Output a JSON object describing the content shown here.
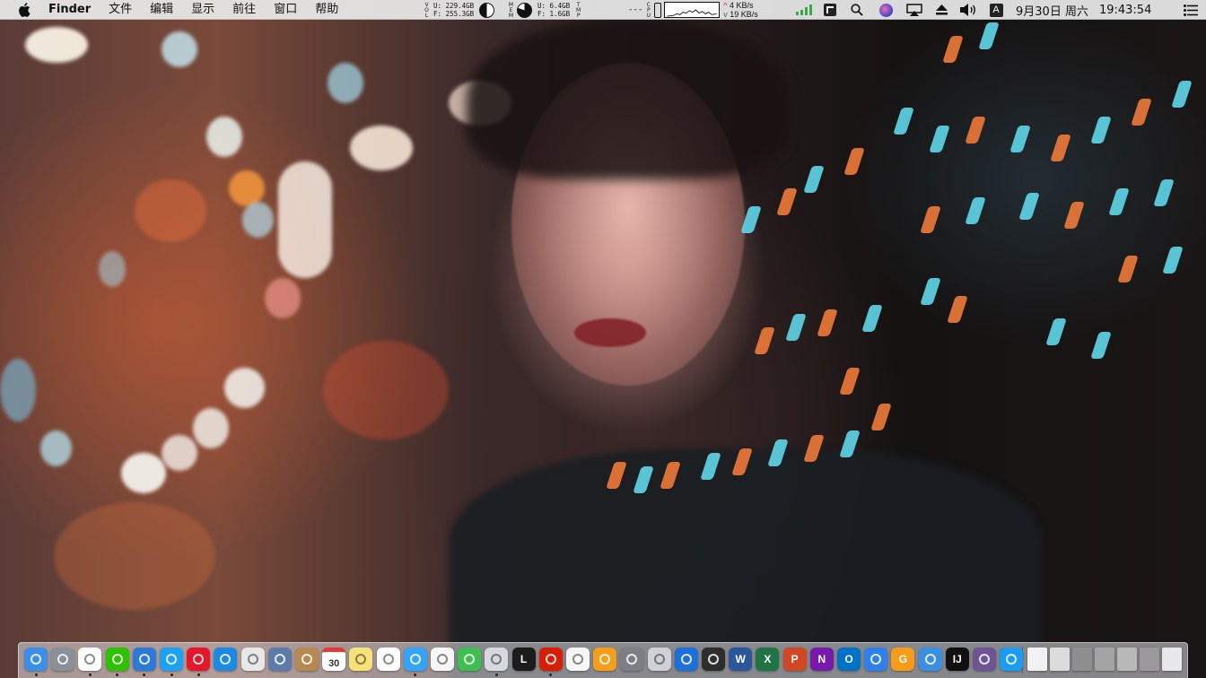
{
  "menubar": {
    "app_name": "Finder",
    "items": [
      "文件",
      "编辑",
      "显示",
      "前往",
      "窗口",
      "帮助"
    ]
  },
  "status": {
    "disk_label": "VOL",
    "disk_used": "U: 229.4GB",
    "disk_free": "F: 255.3GB",
    "mem_label": "MEM",
    "mem_used": "U:     6.4GB",
    "mem_free": "F:     1.6GB",
    "tmp_label": "TMP",
    "cpu_label": "CPU",
    "cpu_bars": "---",
    "net_up": "4 KB/s",
    "net_down": "19 KB/s",
    "input_method": "A",
    "date": "9月30日 周六",
    "time": "19:43:54"
  },
  "status_icons": [
    "signal-bars-icon",
    "screen-capture-icon",
    "spotlight-search-icon",
    "siri-icon",
    "airplay-icon",
    "eject-icon",
    "volume-icon",
    "input-method-icon",
    "notification-center-icon"
  ],
  "dock": {
    "calendar_day": "30",
    "items": [
      {
        "name": "finder-icon",
        "color": "#3d8ee8",
        "glyph": "",
        "dot": true
      },
      {
        "name": "launchpad-icon",
        "color": "#8a8f99",
        "glyph": "",
        "dot": false
      },
      {
        "name": "qq-icon",
        "color": "#ffffff",
        "glyph": "",
        "dot": true
      },
      {
        "name": "wechat-icon",
        "color": "#2dc100",
        "glyph": "",
        "dot": true
      },
      {
        "name": "mail-icon",
        "color": "#2d7ad6",
        "glyph": "",
        "dot": true
      },
      {
        "name": "twitter-icon",
        "color": "#1da1f2",
        "glyph": "",
        "dot": true
      },
      {
        "name": "weibo-icon",
        "color": "#e6162d",
        "glyph": "",
        "dot": true
      },
      {
        "name": "safari-icon",
        "color": "#1e88e5",
        "glyph": "",
        "dot": false
      },
      {
        "name": "chrome-icon",
        "color": "#e8e8e8",
        "glyph": "",
        "dot": false
      },
      {
        "name": "preview-icon",
        "color": "#5b7ba8",
        "glyph": "",
        "dot": false
      },
      {
        "name": "notebook-icon",
        "color": "#b5894f",
        "glyph": "",
        "dot": false
      },
      {
        "name": "calendar-icon",
        "color": "#ffffff",
        "glyph": "30",
        "dot": false
      },
      {
        "name": "stickies-icon",
        "color": "#f7e27a",
        "glyph": "",
        "dot": false
      },
      {
        "name": "reminders-icon",
        "color": "#fdfdfd",
        "glyph": "",
        "dot": false
      },
      {
        "name": "messages-icon",
        "color": "#35a3f7",
        "glyph": "",
        "dot": true
      },
      {
        "name": "photos-icon",
        "color": "#f7f7f7",
        "glyph": "",
        "dot": false
      },
      {
        "name": "infuse-icon",
        "color": "#3fbf4f",
        "glyph": "",
        "dot": false
      },
      {
        "name": "cloud-drive-icon",
        "color": "#d8d8e0",
        "glyph": "",
        "dot": true
      },
      {
        "name": "lightroom-icon",
        "color": "#1c1c1c",
        "glyph": "L",
        "dot": false
      },
      {
        "name": "netease-music-icon",
        "color": "#d81e06",
        "glyph": "",
        "dot": true
      },
      {
        "name": "itunes-icon",
        "color": "#f6f6f6",
        "glyph": "",
        "dot": false
      },
      {
        "name": "ibooks-icon",
        "color": "#f59e1b",
        "glyph": "",
        "dot": false
      },
      {
        "name": "system-preferences-icon",
        "color": "#7d7f84",
        "glyph": "",
        "dot": false
      },
      {
        "name": "tomato-timer-icon",
        "color": "#cfd1d6",
        "glyph": "",
        "dot": false
      },
      {
        "name": "qq-browser-icon",
        "color": "#1e6fd9",
        "glyph": "",
        "dot": false
      },
      {
        "name": "vim-icon",
        "color": "#2e2e2e",
        "glyph": "",
        "dot": false
      },
      {
        "name": "word-icon",
        "color": "#2b579a",
        "glyph": "W",
        "dot": false
      },
      {
        "name": "excel-icon",
        "color": "#217346",
        "glyph": "X",
        "dot": false
      },
      {
        "name": "powerpoint-icon",
        "color": "#d24726",
        "glyph": "P",
        "dot": false
      },
      {
        "name": "onenote-icon",
        "color": "#7719aa",
        "glyph": "N",
        "dot": false
      },
      {
        "name": "outlook-icon",
        "color": "#0072c6",
        "glyph": "O",
        "dot": false
      },
      {
        "name": "keynote-icon",
        "color": "#2f80ed",
        "glyph": "",
        "dot": false
      },
      {
        "name": "gifox-icon",
        "color": "#f59c1a",
        "glyph": "G",
        "dot": false
      },
      {
        "name": "xcode-icon",
        "color": "#3b8fe0",
        "glyph": "",
        "dot": false
      },
      {
        "name": "intellij-icon",
        "color": "#111111",
        "glyph": "IJ",
        "dot": false
      },
      {
        "name": "github-desktop-icon",
        "color": "#6e5494",
        "glyph": "",
        "dot": false
      },
      {
        "name": "app-store-icon",
        "color": "#1b9cf2",
        "glyph": "",
        "dot": false
      }
    ],
    "right_items": [
      {
        "name": "document-stack-icon",
        "color": "#f2f2f2"
      },
      {
        "name": "downloads-stack-icon",
        "color": "#dcdcdc"
      },
      {
        "name": "screenshot-thumbnail-1",
        "color": "#8e8e8e"
      },
      {
        "name": "screenshot-thumbnail-2",
        "color": "#a4a4a4"
      },
      {
        "name": "screenshot-thumbnail-3",
        "color": "#b8b8b8"
      },
      {
        "name": "screenshot-thumbnail-4",
        "color": "#9a9a9a"
      },
      {
        "name": "trash-icon",
        "color": "#e8e8ea"
      }
    ]
  }
}
